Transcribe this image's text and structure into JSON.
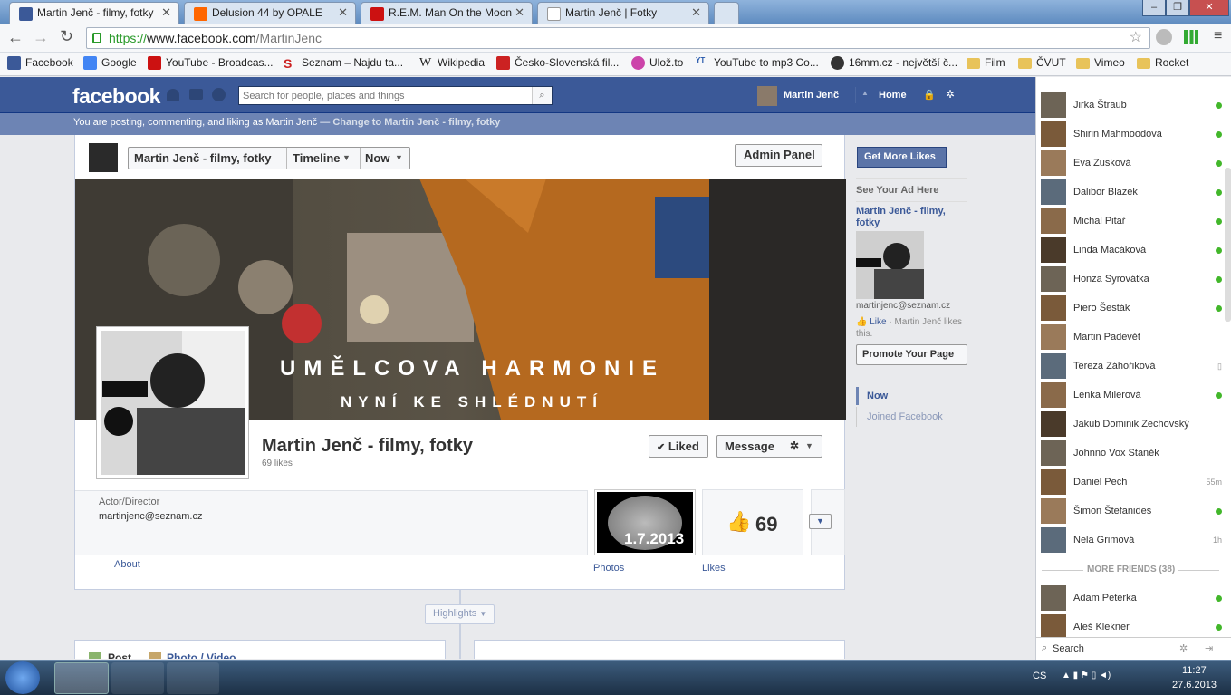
{
  "browser": {
    "tabs": [
      {
        "title": "Martin Jenč - filmy, fotky",
        "color": "#3b5998"
      },
      {
        "title": "Delusion 44 by OPALE",
        "color": "#ff6600"
      },
      {
        "title": "R.E.M. Man On the Moon",
        "color": "#cc1111"
      },
      {
        "title": "Martin Jenč | Fotky",
        "color": "#dddddd"
      }
    ],
    "url_prefix": "https://",
    "url_host": "www.facebook.com",
    "url_path": "/MartinJenc",
    "bookmarks": [
      {
        "label": "Facebook",
        "color": "#3b5998"
      },
      {
        "label": "Google",
        "color": "#4285f4"
      },
      {
        "label": "YouTube - Broadcas...",
        "color": "#cc1111"
      },
      {
        "label": "Seznam – Najdu ta...",
        "color": "#cc2222"
      },
      {
        "label": "Wikipedia",
        "color": "#ffffff"
      },
      {
        "label": "Česko-Slovenská fil...",
        "color": "#cc2222"
      },
      {
        "label": "Ulož.to",
        "color": "#cc44aa"
      },
      {
        "label": "YouTube to mp3 Co...",
        "color": "#2255aa"
      },
      {
        "label": "16mm.cz - největší č...",
        "color": "#333333"
      },
      {
        "label": "Film",
        "color": "#e8c35a"
      },
      {
        "label": "ČVUT",
        "color": "#e8c35a"
      },
      {
        "label": "Vimeo",
        "color": "#e8c35a"
      },
      {
        "label": "Rocket",
        "color": "#e8c35a"
      }
    ]
  },
  "fb": {
    "logo": "facebook",
    "search_placeholder": "Search for people, places and things",
    "user_name": "Martin Jenč",
    "home": "Home",
    "posting_as": "You are posting, commenting, and liking as Martin Jenč — ",
    "change_link": "Change to Martin Jenč - filmy, fotky",
    "page_name_btn": "Martin Jenč - filmy, fotky",
    "timeline_btn": "Timeline",
    "now_btn": "Now",
    "admin_panel": "Admin Panel",
    "cover_line1": "UMĚLCOVA HARMONIE",
    "cover_line2": "NYNÍ KE SHLÉDNUTÍ",
    "page_title": "Martin Jenč - filmy, fotky",
    "likes_count_text": "69 likes",
    "liked_btn": "Liked",
    "message_btn": "Message",
    "category": "Actor/Director",
    "email": "martinjenc@seznam.cz",
    "about": "About",
    "photos_label": "Photos",
    "photo_date": "1.7.2013",
    "likes_label": "Likes",
    "likes_number": "69",
    "highlights": "Highlights",
    "post_tab": "Post",
    "photo_tab": "Photo / Video",
    "get_more_likes": "Get More Likes",
    "see_your_ad": "See Your Ad Here",
    "ad_title": "Martin Jenč - filmy, fotky",
    "ad_email": "martinjenc@seznam.cz",
    "ad_like": "Like",
    "ad_likes_this": " · Martin Jenč likes this.",
    "promote": "Promote Your Page",
    "nav_now": "Now",
    "nav_joined": "Joined Facebook"
  },
  "chat": {
    "friends": [
      {
        "name": "Jirka Štraub",
        "status": "online"
      },
      {
        "name": "Shirin Mahmoodová",
        "status": "online"
      },
      {
        "name": "Eva Zusková",
        "status": "online"
      },
      {
        "name": "Dalibor Blazek",
        "status": "online"
      },
      {
        "name": "Michal Pitař",
        "status": "online"
      },
      {
        "name": "Linda Macáková",
        "status": "online"
      },
      {
        "name": "Honza Syrovátka",
        "status": "online"
      },
      {
        "name": "Piero Šesták",
        "status": "online"
      },
      {
        "name": "Martin Padevět",
        "status": "none"
      },
      {
        "name": "Tereza Záhořiková",
        "status": "mobile"
      },
      {
        "name": "Lenka Milerová",
        "status": "online"
      },
      {
        "name": "Jakub Dominik Zechovský",
        "status": "none"
      },
      {
        "name": "Johnno Vox Staněk",
        "status": "none"
      },
      {
        "name": "Daniel Pech",
        "status": "55m"
      },
      {
        "name": "Šimon Štefanides",
        "status": "online"
      },
      {
        "name": "Nela Grimová",
        "status": "1h"
      }
    ],
    "more_friends": "MORE FRIENDS (38)",
    "more": [
      {
        "name": "Adam Peterka",
        "status": "online"
      },
      {
        "name": "Aleš Klekner",
        "status": "online"
      }
    ],
    "search": "Search"
  },
  "taskbar": {
    "lang": "CS",
    "time": "11:27",
    "date": "27.6.2013"
  }
}
